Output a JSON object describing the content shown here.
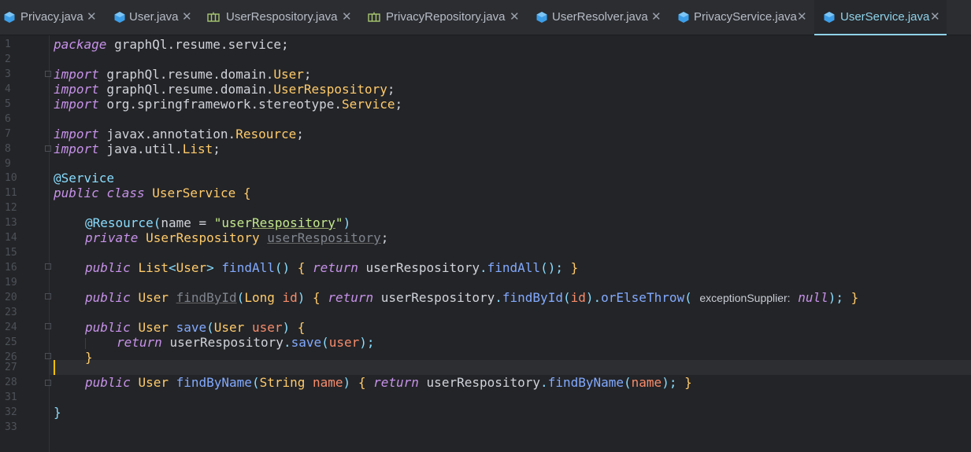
{
  "tabs": [
    {
      "label": "Privacy.java",
      "icon": "class-icon"
    },
    {
      "label": "User.java",
      "icon": "class-icon"
    },
    {
      "label": "UserRespository.java",
      "icon": "interface-icon"
    },
    {
      "label": "PrivacyRepository.java",
      "icon": "interface-icon"
    },
    {
      "label": "UserResolver.java",
      "icon": "class-icon"
    },
    {
      "label": "PrivacyService.java",
      "icon": "class-icon"
    },
    {
      "label": "UserService.java",
      "icon": "class-icon",
      "active": true
    }
  ],
  "close_glyph": "✕",
  "line_numbers": [
    "1",
    "2",
    "3",
    "4",
    "5",
    "6",
    "7",
    "8",
    "9",
    "10",
    "11",
    "12",
    "13",
    "14",
    "15",
    "16",
    "19",
    "20",
    "23",
    "24",
    "25",
    "26",
    "27",
    "28",
    "31",
    "32",
    "33"
  ],
  "code": {
    "l1": {
      "kw": "package",
      "rest": " graphQl.resume.service;"
    },
    "l3": {
      "kw": "import",
      "rest": " graphQl.resume.domain.",
      "cls": "User",
      "end": ";"
    },
    "l4": {
      "kw": "import",
      "rest": " graphQl.resume.domain.",
      "cls": "UserRespository",
      "end": ";"
    },
    "l5": {
      "kw": "import",
      "rest": " org.springframework.stereotype.",
      "cls": "Service",
      "end": ";"
    },
    "l7": {
      "kw": "import",
      "rest": " javax.annotation.",
      "cls": "Resource",
      "end": ";"
    },
    "l8": {
      "kw": "import",
      "rest": " java.util.",
      "cls": "List",
      "end": ";"
    },
    "l10": {
      "ann": "@Service"
    },
    "l11": {
      "kw1": "public",
      "kw2": "class",
      "cls": "UserService",
      "brace": "{"
    },
    "l13": {
      "ann": "@Resource",
      "open": "(",
      "param": "name",
      "eq": " = ",
      "str_a": "\"user",
      "str_b": "Respository",
      "str_c": "\"",
      "close": ")"
    },
    "l14": {
      "kw": "private",
      "cls": "UserRespository",
      "field": "userRespository",
      "end": ";"
    },
    "l16": {
      "kw": "public",
      "cls": "List",
      "lt": "<",
      "gen": "User",
      "gt": ">",
      "fn": "findAll",
      "par": "()",
      "ob": "{",
      "ret": "return",
      "obj": "userRespository",
      "dot": ".",
      "call": "findAll",
      "args": "();",
      "cb": "}"
    },
    "l20": {
      "kw": "public",
      "cls": "User",
      "fn": "findById",
      "p1": "(",
      "type": "Long",
      "param": "id",
      "p2": ")",
      "ob": "{",
      "ret": "return",
      "obj": "userRespository",
      "call1": "findById",
      "a1": "(",
      "arg": "id",
      "a2": ")",
      "call2": "orElseThrow",
      "a3": "(",
      "hint": "exceptionSupplier:",
      "nul": "null",
      "a4": ");",
      "cb": "}"
    },
    "l24": {
      "kw": "public",
      "cls": "User",
      "fn": "save",
      "p1": "(",
      "type": "User",
      "param": "user",
      "p2": ")",
      "ob": "{"
    },
    "l25": {
      "ret": "return",
      "obj": "userRespository",
      "call": "save",
      "a1": "(",
      "arg": "user",
      "a2": ");"
    },
    "l26": {
      "cb": "}"
    },
    "l28": {
      "kw": "public",
      "cls": "User",
      "fn": "findByName",
      "p1": "(",
      "type": "String",
      "param": "name",
      "p2": ")",
      "ob": "{",
      "ret": "return",
      "obj": "userRespository",
      "call": "findByName",
      "a1": "(",
      "arg": "name",
      "a2": ");",
      "cb": "}"
    },
    "l32": {
      "cb": "}"
    }
  }
}
